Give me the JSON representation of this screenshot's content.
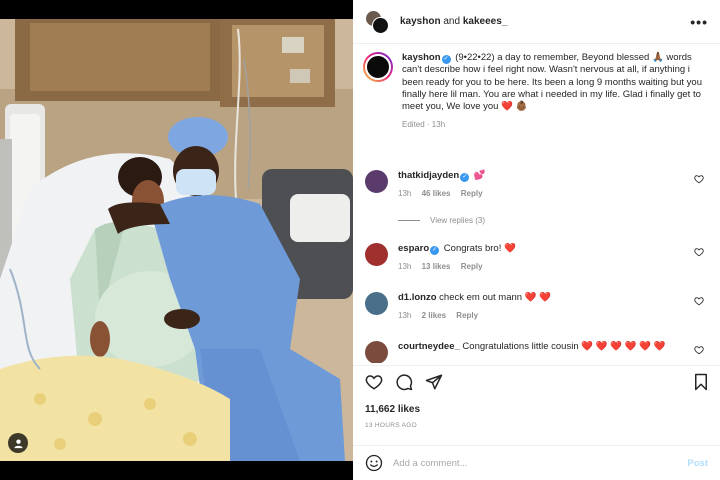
{
  "post": {
    "author_primary": "kayshon",
    "author_and": "and",
    "author_secondary": "kakeees_",
    "more_label": "•••"
  },
  "caption": {
    "username": "kayshon",
    "text": "(9•22•22) a day to remember, Beyond blessed 🙏🏾 words can't describe how i feel right now. Wasn't nervous at all, if anything i been ready for you to be here. Its been a long 9 months waiting but you finally here lil man. You are what i needed in my life. Glad i finally get to meet you, We love you ❤️ 👶🏾",
    "meta": "Edited · 13h"
  },
  "comments": [
    {
      "username": "thatkidjayden",
      "verified": true,
      "text": "💕",
      "time": "13h",
      "likes": "46 likes",
      "reply": "Reply",
      "avatar_color": "#5a3b6b"
    },
    {
      "username": "esparo",
      "verified": true,
      "text": "Congrats bro! ❤️",
      "time": "13h",
      "likes": "13 likes",
      "reply": "Reply",
      "avatar_color": "#a0302e"
    },
    {
      "username": "d1.lonzo",
      "verified": false,
      "text": "check em out mann ❤️ ❤️",
      "time": "13h",
      "likes": "2 likes",
      "reply": "Reply",
      "avatar_color": "#4a6f8a"
    },
    {
      "username": "courtneydee_",
      "verified": false,
      "text": "Congratulations little cousin ❤️ ❤️ ❤️ ❤️ ❤️ ❤️",
      "avatar_color": "#7b4b3e"
    }
  ],
  "view_replies": "View replies (3)",
  "likes": "11,662 likes",
  "time_ago": "13 HOURS AGO",
  "comment_input": {
    "placeholder": "Add a comment..."
  },
  "post_button": "Post",
  "icons": {
    "heart": "heart-icon",
    "comment": "comment-icon",
    "share": "share-icon",
    "save": "bookmark-icon",
    "emoji": "emoji-icon",
    "user_tag": "user-tag-icon"
  },
  "colors": {
    "link_blue": "#3897f0",
    "heart_red": "#ed4956",
    "post_disabled": "#b2dffc",
    "meta_gray": "#8e8e8e"
  }
}
